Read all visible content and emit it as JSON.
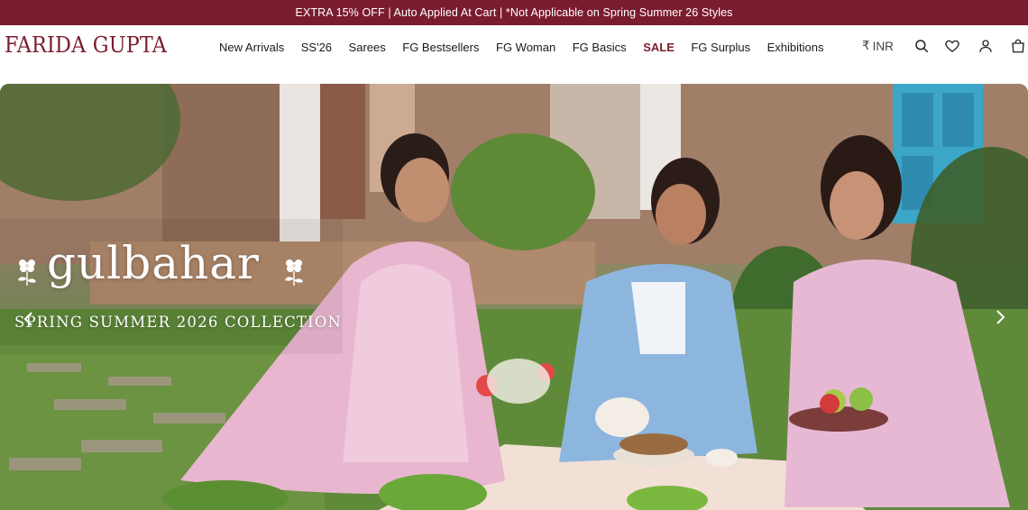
{
  "promo": {
    "text": "EXTRA 15% OFF | Auto Applied At Cart | *Not Applicable on Spring Summer 26 Styles"
  },
  "header": {
    "logo": "FARIDA GUPTA",
    "nav": [
      {
        "label": "New Arrivals"
      },
      {
        "label": "SS'26"
      },
      {
        "label": "Sarees"
      },
      {
        "label": "FG Bestsellers"
      },
      {
        "label": "FG Woman"
      },
      {
        "label": "FG Basics"
      },
      {
        "label": "SALE"
      },
      {
        "label": "FG Surplus"
      },
      {
        "label": "Exhibitions"
      }
    ],
    "currency": {
      "symbol": "₹",
      "code": "INR"
    },
    "icons": [
      "search-icon",
      "wishlist-heart-icon",
      "account-user-icon",
      "cart-bag-icon"
    ]
  },
  "hero": {
    "title": "gulbahar",
    "subtitle": "SPRING SUMMER 2026 COLLECTION",
    "icons": [
      "flower-icon",
      "chevron-left-icon",
      "chevron-right-icon"
    ]
  },
  "colors": {
    "brand": "#7a1c2e",
    "promo_bg": "#7a1c2e",
    "text": "#1a1a1a"
  }
}
